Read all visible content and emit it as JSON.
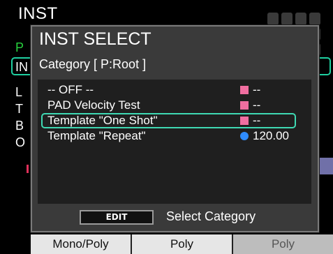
{
  "background": {
    "title": "INST",
    "left_letters": [
      "P",
      "IN",
      "L",
      "T",
      "B",
      "O"
    ],
    "bottom": [
      "Mono/Poly",
      "Poly",
      "Poly"
    ]
  },
  "dialog": {
    "title": "INST SELECT",
    "category": "Category [ P:Root ]",
    "items": [
      {
        "name": "-- OFF --",
        "value": "--",
        "marker": "pink-square-icon"
      },
      {
        "name": "PAD Velocity Test",
        "value": "--",
        "marker": "pink-square-icon"
      },
      {
        "name": "Template \"One Shot\"",
        "value": "--",
        "marker": "pink-square-icon",
        "selected": true
      },
      {
        "name": "Template \"Repeat\"",
        "value": "120.00",
        "marker": "blue-dot-icon"
      }
    ],
    "edit_label": "EDIT",
    "footer_label": "Select Category"
  },
  "colors": {
    "selection_outline": "#3fd9b3",
    "marker_pink": "#f06ea0",
    "marker_blue": "#2f8cff",
    "active_green": "#27d23e"
  }
}
